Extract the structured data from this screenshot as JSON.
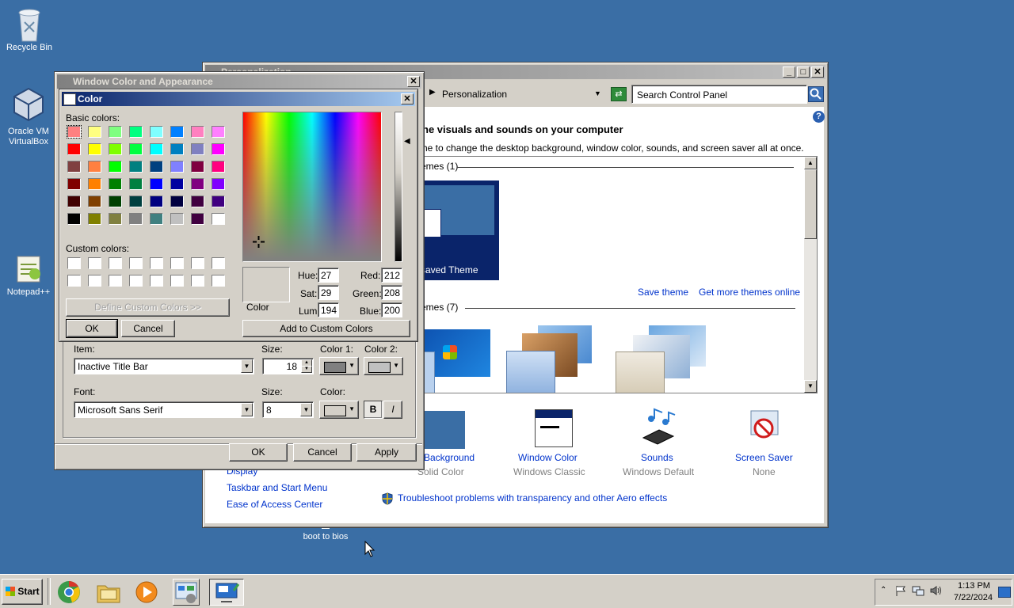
{
  "desktop": {
    "icons": [
      {
        "label": "Recycle Bin"
      },
      {
        "label": "Oracle VM\nVirtualBox"
      },
      {
        "label": "Notepad++"
      },
      {
        "label": "boot to bios"
      }
    ]
  },
  "personalization": {
    "title": "Personalization",
    "address": "Personalization",
    "search_placeholder": "Search Control Panel",
    "heading": "he visuals and sounds on your computer",
    "subheading": "he to change the desktop background, window color, sounds, and screen saver all at once.",
    "my_themes": "emes (1)",
    "saved_theme": "saved Theme",
    "save_theme": "Save theme",
    "get_more": "Get more themes online",
    "aero_themes": "emes (7)",
    "bottom_items": [
      {
        "title": "p Background",
        "sub": "Solid Color"
      },
      {
        "title": "Window Color",
        "sub": "Windows Classic"
      },
      {
        "title": "Sounds",
        "sub": "Windows Default"
      },
      {
        "title": "Screen Saver",
        "sub": "None"
      }
    ],
    "see_also": [
      "Display",
      "Taskbar and Start Menu",
      "Ease of Access Center"
    ],
    "troubleshoot": "Troubleshoot problems with transparency and other Aero effects"
  },
  "wca": {
    "title": "Window Color and Appearance",
    "item_label": "Item:",
    "item_value": "Inactive Title Bar",
    "size_label": "Size:",
    "size_value": "18",
    "color1_label": "Color 1:",
    "color2_label": "Color 2:",
    "font_label": "Font:",
    "font_value": "Microsoft Sans Serif",
    "font_size_label": "Size:",
    "font_size_value": "8",
    "font_color_label": "Color:",
    "bold": "B",
    "italic": "I",
    "ok": "OK",
    "cancel": "Cancel",
    "apply": "Apply"
  },
  "color": {
    "title": "Color",
    "basic_label": "Basic colors:",
    "custom_label": "Custom colors:",
    "define_custom": "Define Custom Colors >>",
    "ok": "OK",
    "cancel": "Cancel",
    "preview_label": "Color",
    "hue_label": "Hue:",
    "hue": "27",
    "sat_label": "Sat:",
    "sat": "29",
    "lum_label": "Lum:",
    "lum": "194",
    "red_label": "Red:",
    "red": "212",
    "green_label": "Green:",
    "green": "208",
    "blue_label": "Blue:",
    "blue": "200",
    "add_custom": "Add to Custom Colors",
    "basic_colors": [
      "#ff8080",
      "#ffff80",
      "#80ff80",
      "#00ff80",
      "#80ffff",
      "#0080ff",
      "#ff80c0",
      "#ff80ff",
      "#ff0000",
      "#ffff00",
      "#80ff00",
      "#00ff40",
      "#00ffff",
      "#0080c0",
      "#8080c0",
      "#ff00ff",
      "#804040",
      "#ff8040",
      "#00ff00",
      "#008080",
      "#004080",
      "#8080ff",
      "#800040",
      "#ff0080",
      "#800000",
      "#ff8000",
      "#008000",
      "#008040",
      "#0000ff",
      "#0000a0",
      "#800080",
      "#8000ff",
      "#400000",
      "#804000",
      "#004000",
      "#004040",
      "#000080",
      "#000040",
      "#400040",
      "#400080",
      "#000000",
      "#808000",
      "#808040",
      "#808080",
      "#408080",
      "#c0c0c0",
      "#400040",
      "#ffffff"
    ],
    "selected_color": "#d4d0c8"
  },
  "taskbar": {
    "start": "Start",
    "time": "1:13 PM",
    "date": "7/22/2024"
  }
}
